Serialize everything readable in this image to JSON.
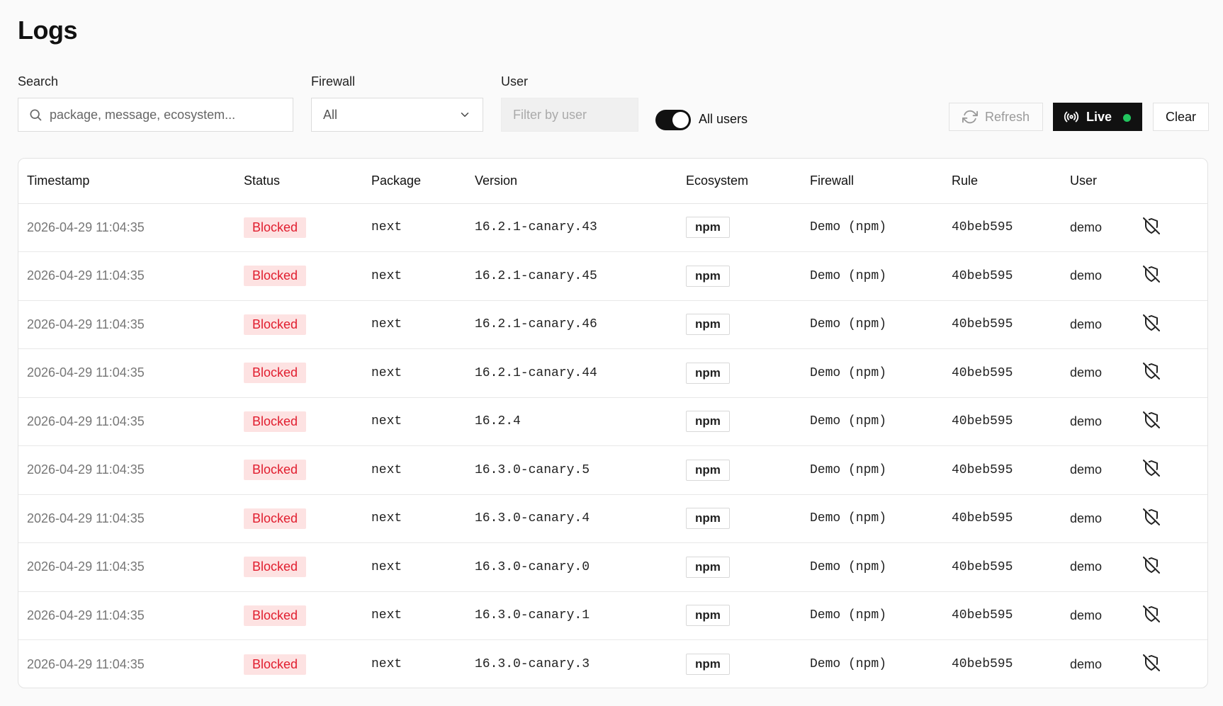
{
  "page": {
    "title": "Logs"
  },
  "filters": {
    "search": {
      "label": "Search",
      "placeholder": "package, message, ecosystem..."
    },
    "firewall": {
      "label": "Firewall",
      "value": "All"
    },
    "user": {
      "label": "User",
      "placeholder": "Filter by user"
    },
    "all_users": {
      "label": "All users",
      "on": true
    }
  },
  "toolbar": {
    "refresh_label": "Refresh",
    "live_label": "Live",
    "clear_label": "Clear"
  },
  "colors": {
    "blocked_text": "#e11d2e",
    "blocked_bg": "#fde2e2",
    "live_dot": "#22c55e",
    "dark": "#111111"
  },
  "table": {
    "columns": [
      "Timestamp",
      "Status",
      "Package",
      "Version",
      "Ecosystem",
      "Firewall",
      "Rule",
      "User"
    ],
    "rows": [
      {
        "timestamp": "2026-04-29 11:04:35",
        "status": "Blocked",
        "package": "next",
        "version": "16.2.1-canary.43",
        "ecosystem": "npm",
        "firewall": "Demo (npm)",
        "rule": "40beb595",
        "user": "demo",
        "action_icon": "shield-off-icon"
      },
      {
        "timestamp": "2026-04-29 11:04:35",
        "status": "Blocked",
        "package": "next",
        "version": "16.2.1-canary.45",
        "ecosystem": "npm",
        "firewall": "Demo (npm)",
        "rule": "40beb595",
        "user": "demo",
        "action_icon": "shield-off-icon"
      },
      {
        "timestamp": "2026-04-29 11:04:35",
        "status": "Blocked",
        "package": "next",
        "version": "16.2.1-canary.46",
        "ecosystem": "npm",
        "firewall": "Demo (npm)",
        "rule": "40beb595",
        "user": "demo",
        "action_icon": "shield-off-icon"
      },
      {
        "timestamp": "2026-04-29 11:04:35",
        "status": "Blocked",
        "package": "next",
        "version": "16.2.1-canary.44",
        "ecosystem": "npm",
        "firewall": "Demo (npm)",
        "rule": "40beb595",
        "user": "demo",
        "action_icon": "shield-off-icon"
      },
      {
        "timestamp": "2026-04-29 11:04:35",
        "status": "Blocked",
        "package": "next",
        "version": "16.2.4",
        "ecosystem": "npm",
        "firewall": "Demo (npm)",
        "rule": "40beb595",
        "user": "demo",
        "action_icon": "shield-off-icon"
      },
      {
        "timestamp": "2026-04-29 11:04:35",
        "status": "Blocked",
        "package": "next",
        "version": "16.3.0-canary.5",
        "ecosystem": "npm",
        "firewall": "Demo (npm)",
        "rule": "40beb595",
        "user": "demo",
        "action_icon": "shield-off-icon"
      },
      {
        "timestamp": "2026-04-29 11:04:35",
        "status": "Blocked",
        "package": "next",
        "version": "16.3.0-canary.4",
        "ecosystem": "npm",
        "firewall": "Demo (npm)",
        "rule": "40beb595",
        "user": "demo",
        "action_icon": "shield-off-icon"
      },
      {
        "timestamp": "2026-04-29 11:04:35",
        "status": "Blocked",
        "package": "next",
        "version": "16.3.0-canary.0",
        "ecosystem": "npm",
        "firewall": "Demo (npm)",
        "rule": "40beb595",
        "user": "demo",
        "action_icon": "shield-off-icon"
      },
      {
        "timestamp": "2026-04-29 11:04:35",
        "status": "Blocked",
        "package": "next",
        "version": "16.3.0-canary.1",
        "ecosystem": "npm",
        "firewall": "Demo (npm)",
        "rule": "40beb595",
        "user": "demo",
        "action_icon": "shield-off-icon"
      },
      {
        "timestamp": "2026-04-29 11:04:35",
        "status": "Blocked",
        "package": "next",
        "version": "16.3.0-canary.3",
        "ecosystem": "npm",
        "firewall": "Demo (npm)",
        "rule": "40beb595",
        "user": "demo",
        "action_icon": "shield-off-icon"
      }
    ]
  }
}
